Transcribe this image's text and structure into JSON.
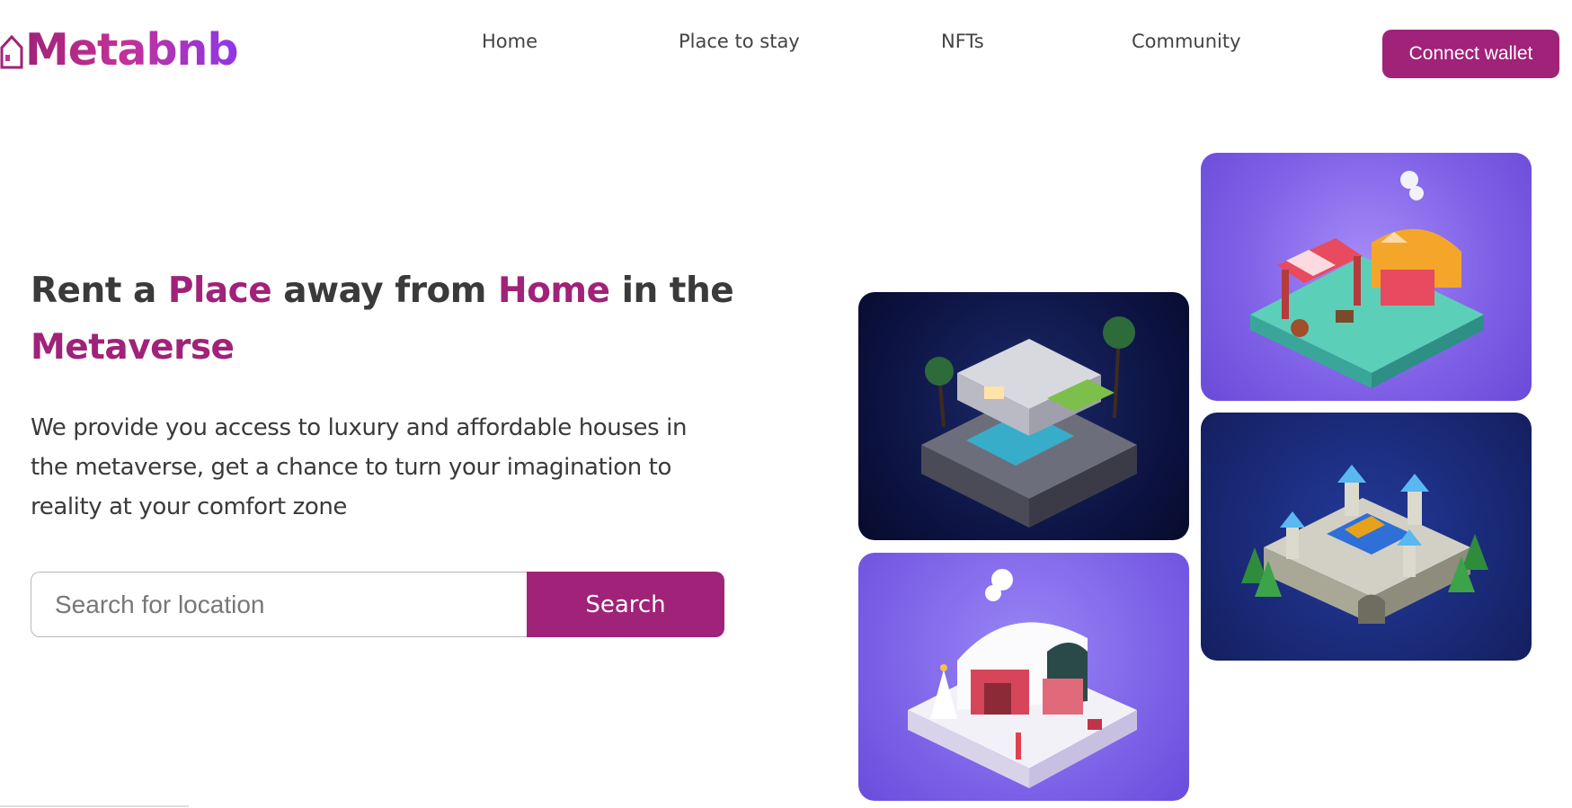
{
  "header": {
    "logo_text": "Metabnb",
    "nav": [
      "Home",
      "Place to stay",
      "NFTs",
      "Community"
    ],
    "connect_label": "Connect wallet"
  },
  "hero": {
    "headline": {
      "part1": "Rent a ",
      "accent1": "Place",
      "part2": " away from ",
      "accent2": "Home",
      "part3": " in the ",
      "accent3": "Metaverse"
    },
    "subtext": "We provide you access to luxury and affordable houses in the metaverse, get a chance to turn your imagination to reality at your comfort zone",
    "search": {
      "placeholder": "Search for location",
      "button_label": "Search"
    }
  },
  "colors": {
    "brand": "#a02279",
    "logo_gradient_end": "#8f37e6",
    "text": "#3a3a3a"
  },
  "gallery": [
    {
      "name": "modern-villa-image"
    },
    {
      "name": "market-stall-image"
    },
    {
      "name": "castle-image"
    },
    {
      "name": "snow-house-image"
    }
  ]
}
